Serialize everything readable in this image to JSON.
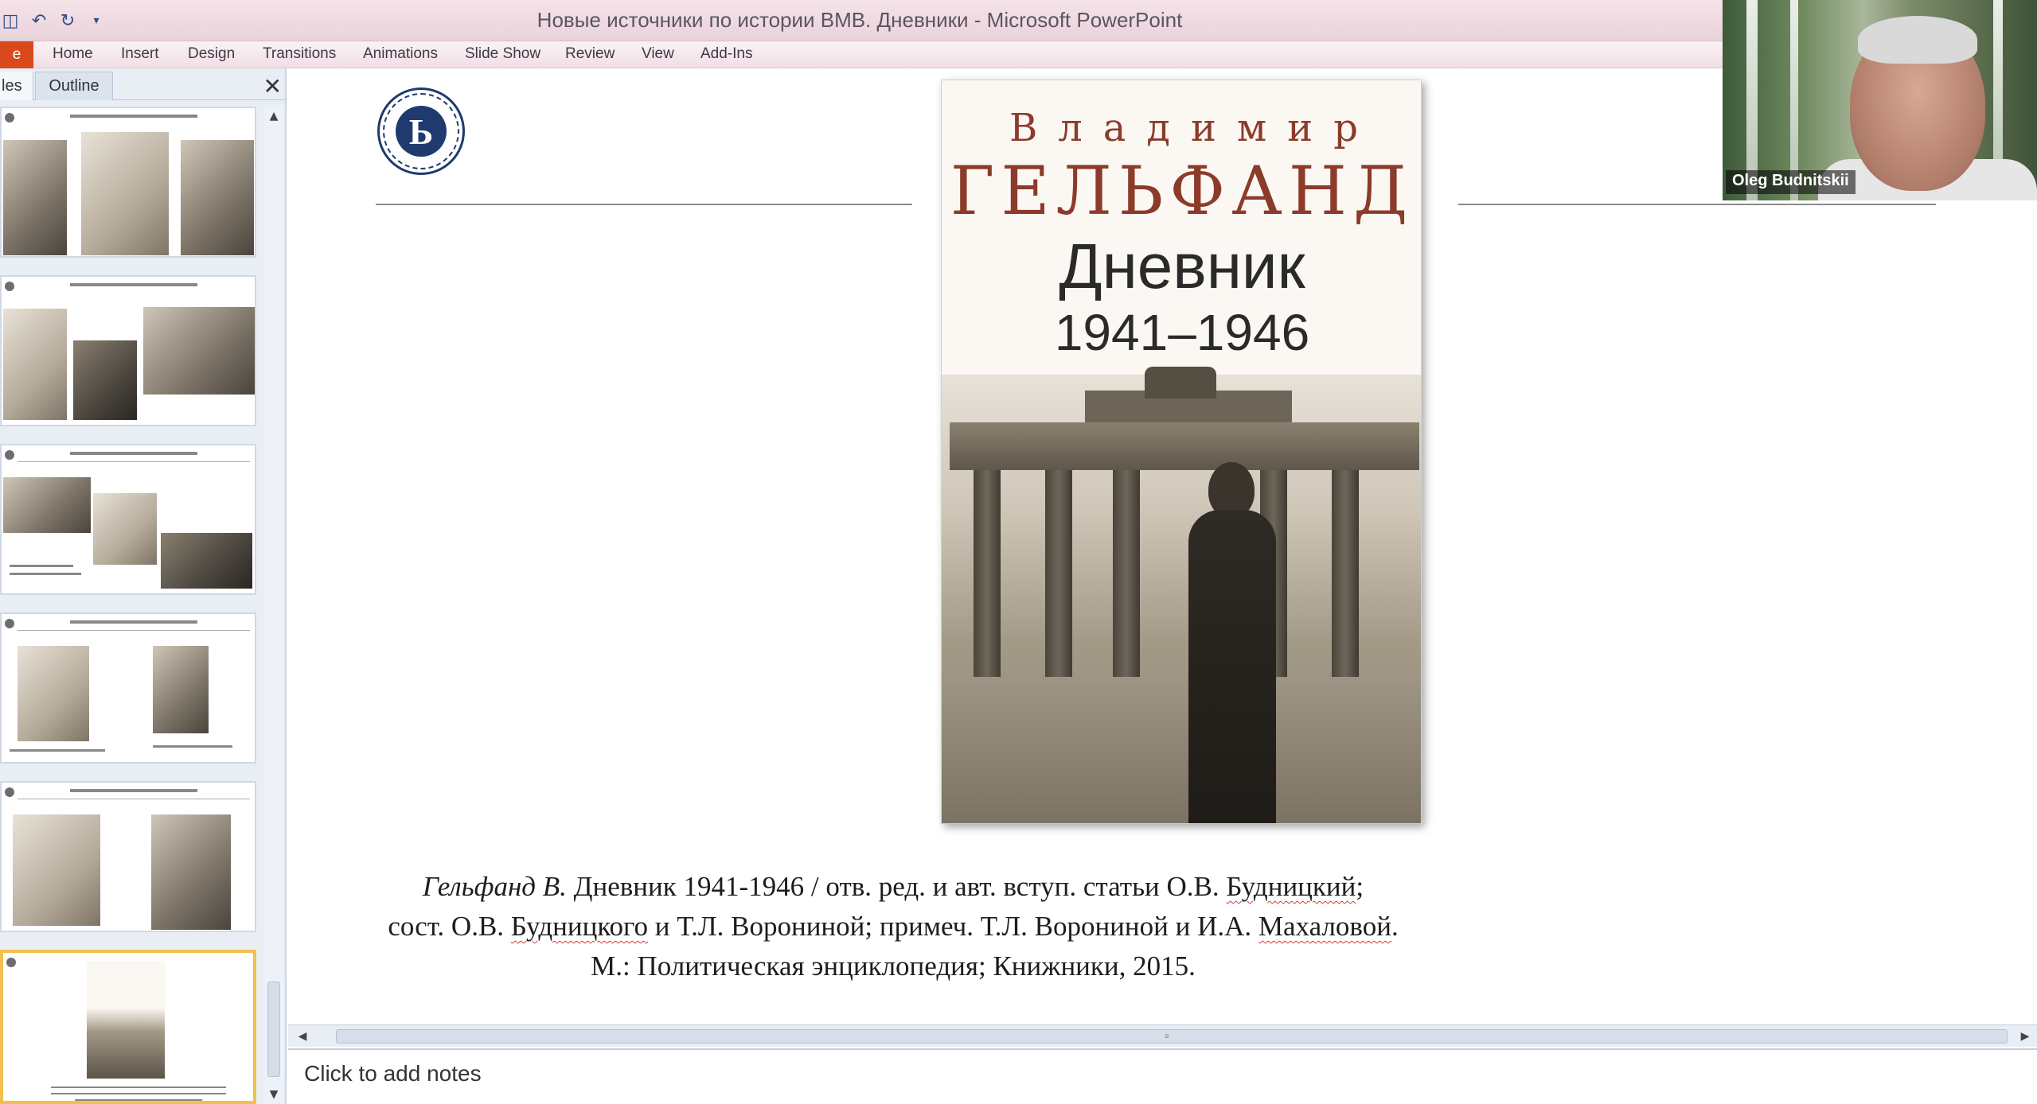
{
  "window": {
    "title": "Новые источники по истории ВМВ. Дневники - Microsoft PowerPoint"
  },
  "quick_access": {
    "save_icon": "save-icon",
    "undo_icon": "undo-icon",
    "redo_icon": "redo-icon",
    "customize_icon": "customize-icon"
  },
  "ribbon": {
    "file_tab": "e",
    "tabs": [
      "Home",
      "Insert",
      "Design",
      "Transitions",
      "Animations",
      "Slide Show",
      "Review",
      "View",
      "Add-Ins"
    ]
  },
  "left_pane": {
    "tab_slides": "les",
    "tab_outline": "Outline",
    "close_icon": "close-icon",
    "selected_slide": 6
  },
  "slide": {
    "book_cover": {
      "first_name": "Владимир",
      "last_name": "ГЕЛЬФАНД",
      "title": "Дневник",
      "years": "1941–1946"
    },
    "citation": {
      "author_italic": "Гельфанд В.",
      "line1_rest": " Дневник 1941-1946 / отв. ред. и авт. вступ. статьи О.В. ",
      "line1_sq": "Будницкий",
      "line1_end": ";",
      "line2_start": "сост. О.В. ",
      "line2_sq1": "Будницкого",
      "line2_mid": " и Т.Л. Ворониной; примеч. Т.Л. Ворониной и И.А. ",
      "line2_sq2": "Махаловой",
      "line2_end": ".",
      "line3": "М.: Политическая энциклопедия; Книжники, 2015."
    }
  },
  "notes": {
    "placeholder": "Click to add notes"
  },
  "video": {
    "participant_name": "Oleg Budnitskii"
  },
  "colors": {
    "accent_file_tab": "#d84a1b",
    "book_name_color": "#8c3b2a",
    "selected_thumb_border": "#f3c04f"
  }
}
